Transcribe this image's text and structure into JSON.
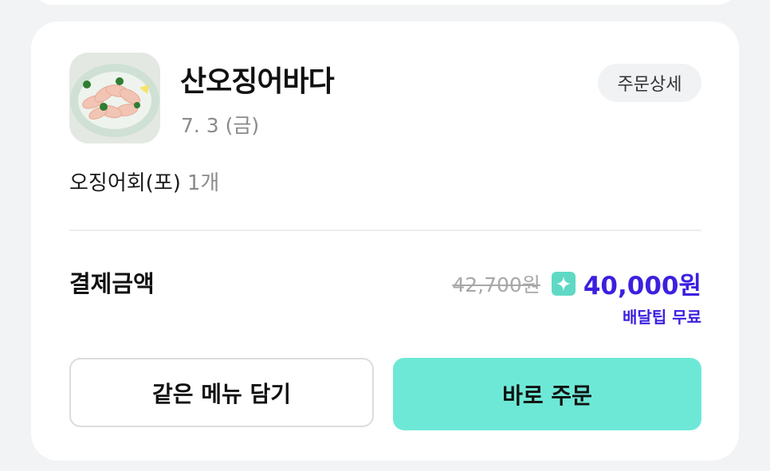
{
  "order": {
    "store_name": "산오징어바다",
    "date": "7. 3 (금)",
    "detail_button": "주문상세",
    "item_name": "오징어회(포)",
    "item_qty": "1개"
  },
  "payment": {
    "label": "결제금액",
    "original_price": "42,700원",
    "final_price": "40,000원",
    "delivery_tip": "배달팁 무료"
  },
  "actions": {
    "reorder_same": "같은 메뉴 담기",
    "order_now": "바로 주문"
  },
  "icons": {
    "thumbnail": "squid-sashimi-plate-image",
    "badge": "sparkle-icon"
  },
  "colors": {
    "accent_price": "#3b20e0",
    "primary_button": "#6ee8d6",
    "badge": "#5fd9c4"
  }
}
